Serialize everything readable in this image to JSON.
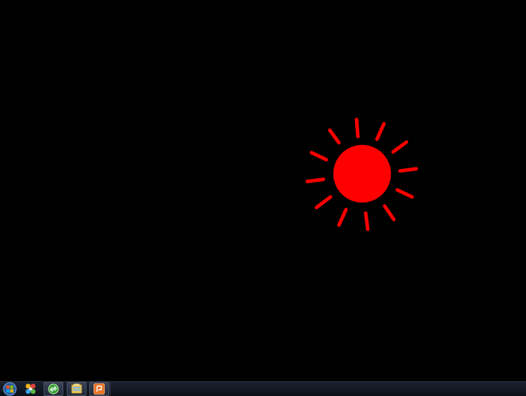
{
  "desktop": {
    "background": "#000000"
  },
  "sun": {
    "icon": "sun-icon",
    "color": "#ff0000"
  },
  "taskbar": {
    "start_icon": "windows-orb-icon",
    "pinned": [
      {
        "icon": "media-center-icon"
      },
      {
        "icon": "green-app-icon"
      },
      {
        "icon": "file-explorer-icon"
      },
      {
        "icon": "presentation-app-icon"
      }
    ]
  }
}
